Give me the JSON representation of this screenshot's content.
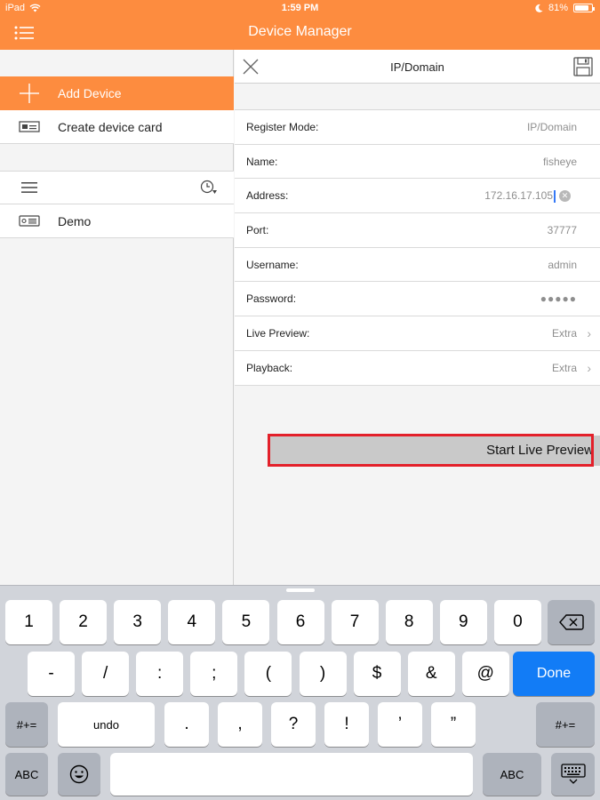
{
  "status": {
    "device": "iPad",
    "time": "1:59 PM",
    "battery": "81%",
    "battery_level": 0.81
  },
  "nav": {
    "title": "Device Manager"
  },
  "left": {
    "items": [
      {
        "label": "Add Device"
      },
      {
        "label": "Create device card"
      }
    ],
    "devices": [
      {
        "label": "Demo"
      }
    ]
  },
  "right": {
    "title": "IP/Domain",
    "fields": [
      {
        "label": "Register Mode:",
        "value": "IP/Domain"
      },
      {
        "label": "Name:",
        "value": "fisheye"
      },
      {
        "label": "Address:",
        "value": "172.16.17.105"
      },
      {
        "label": "Port:",
        "value": "37777"
      },
      {
        "label": "Username:",
        "value": "admin"
      },
      {
        "label": "Password:",
        "value": "●●●●●"
      },
      {
        "label": "Live Preview:",
        "value": "Extra"
      },
      {
        "label": "Playback:",
        "value": "Extra"
      }
    ],
    "start_label": "Start Live Preview"
  },
  "keyboard": {
    "row1": [
      "1",
      "2",
      "3",
      "4",
      "5",
      "6",
      "7",
      "8",
      "9",
      "0"
    ],
    "row2": [
      "-",
      "/",
      ":",
      ";",
      "(",
      ")",
      "$",
      "&",
      "@"
    ],
    "done": "Done",
    "row3_mode": "#+=",
    "undo": "undo",
    "row3": [
      ".",
      ",",
      "?",
      "!",
      "’",
      "”"
    ],
    "abc": "ABC"
  }
}
